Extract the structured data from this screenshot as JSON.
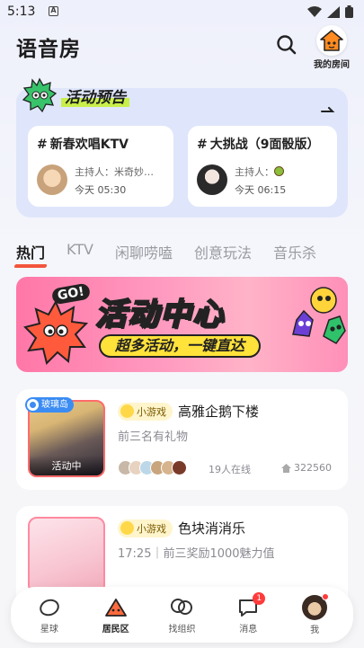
{
  "status_bar": {
    "time": "5:13"
  },
  "header": {
    "title": "语音房",
    "my_room_label": "我的房间"
  },
  "preview": {
    "title": "活动预告",
    "events": [
      {
        "hash": "#",
        "name": "新春欢唱KTV",
        "host": "主持人：米奇妙…",
        "time": "今天 05:30"
      },
      {
        "hash": "#",
        "name": "大挑战（9面骰版）",
        "host": "主持人：",
        "time": "今天 06:15"
      }
    ]
  },
  "tabs": [
    "热门",
    "KTV",
    "闲聊唠嗑",
    "创意玩法",
    "音乐杀"
  ],
  "banner": {
    "go": "GO!",
    "title": "活动中心",
    "subtitle": "超多活动，一键直达"
  },
  "rooms": [
    {
      "tag": "玻璃岛",
      "live": "活动中",
      "chip": "小游戏",
      "name": "高雅企鹅下楼",
      "desc": "前三名有礼物",
      "online": "19人在线",
      "heat": "322560"
    },
    {
      "chip": "小游戏",
      "name": "色块消消乐",
      "desc": "17:25｜前三奖励1000魅力值"
    }
  ],
  "nav": {
    "items": [
      {
        "label": "星球"
      },
      {
        "label": "居民区"
      },
      {
        "label": "找组织"
      },
      {
        "label": "消息",
        "badge": "1"
      },
      {
        "label": "我"
      }
    ]
  },
  "colors": {
    "accent": "#f2553c",
    "panel": "#dfe6fb",
    "badge": "#ff3b3b",
    "tag": "#3b8cf3"
  }
}
